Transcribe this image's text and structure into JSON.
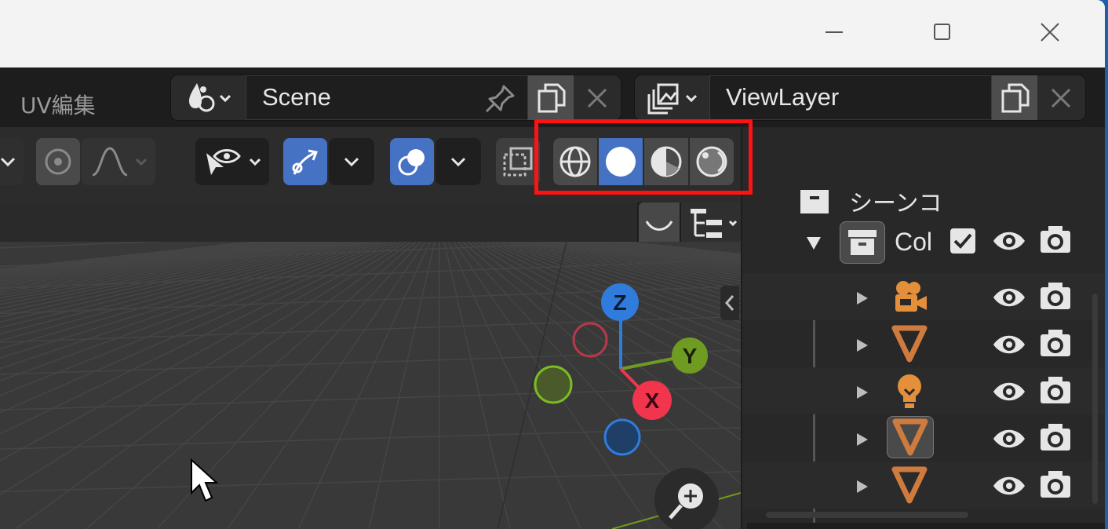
{
  "window": {
    "controls": {
      "minimize": "minimize-icon",
      "maximize": "maximize-icon",
      "close": "close-icon"
    }
  },
  "topbar": {
    "workspace_tab": "UV編集",
    "scene": {
      "value": "Scene",
      "icons": [
        "scene-icon",
        "pin-icon",
        "duplicate-icon",
        "close-icon"
      ]
    },
    "viewlayer": {
      "value": "ViewLayer",
      "icons": [
        "render-layers-icon",
        "duplicate-icon",
        "close-icon"
      ]
    }
  },
  "viewport_header": {
    "shading_modes": [
      "wireframe",
      "solid",
      "material-preview",
      "rendered"
    ],
    "active_shading": "solid",
    "highlight_color": "#ff1212",
    "accent": "#4672c4"
  },
  "gizmo": {
    "axes": {
      "z": "Z",
      "y": "Y",
      "x": "X"
    },
    "colors": {
      "x": "#f0354d",
      "y": "#6f9b22",
      "z": "#2f7cdd"
    }
  },
  "outliner": {
    "scene_label": "シーンコ",
    "collection_label": "Col",
    "rows": [
      {
        "icon": "camera-icon",
        "color": "#e48f3a"
      },
      {
        "icon": "mesh-icon",
        "color": "#d07b3e"
      },
      {
        "icon": "light-icon",
        "color": "#e48f3a"
      },
      {
        "icon": "mesh-icon",
        "color": "#d07b3e"
      },
      {
        "icon": "mesh-icon",
        "color": "#d07b3e"
      }
    ]
  }
}
